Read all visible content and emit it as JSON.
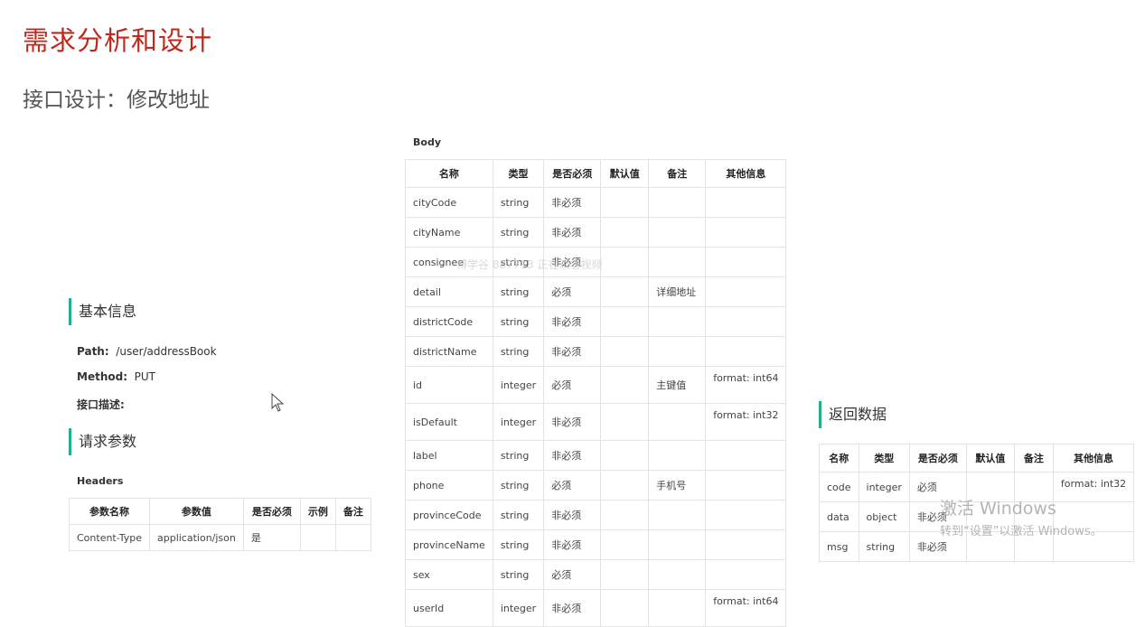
{
  "page": {
    "title": "需求分析和设计",
    "subtitle": "接口设计：修改地址",
    "watermark": "博学谷 887713 正在观看视频"
  },
  "basic": {
    "heading": "基本信息",
    "path_label": "Path:",
    "path_value": "/user/addressBook",
    "method_label": "Method:",
    "method_value": "PUT",
    "desc_label": "接口描述:"
  },
  "request": {
    "heading": "请求参数",
    "headers_label": "Headers",
    "headers_columns": [
      "参数名称",
      "参数值",
      "是否必须",
      "示例",
      "备注"
    ],
    "headers_rows": [
      [
        "Content-Type",
        "application/json",
        "是",
        "",
        ""
      ]
    ]
  },
  "body": {
    "label": "Body",
    "columns": [
      "名称",
      "类型",
      "是否必须",
      "默认值",
      "备注",
      "其他信息"
    ],
    "rows": [
      [
        "cityCode",
        "string",
        "非必须",
        "",
        "",
        ""
      ],
      [
        "cityName",
        "string",
        "非必须",
        "",
        "",
        ""
      ],
      [
        "consignee",
        "string",
        "非必须",
        "",
        "",
        ""
      ],
      [
        "detail",
        "string",
        "必须",
        "",
        "详细地址",
        ""
      ],
      [
        "districtCode",
        "string",
        "非必须",
        "",
        "",
        ""
      ],
      [
        "districtName",
        "string",
        "非必须",
        "",
        "",
        ""
      ],
      [
        "id",
        "integer",
        "必须",
        "",
        "主键值",
        "format: int64"
      ],
      [
        "isDefault",
        "integer",
        "非必须",
        "",
        "",
        "format: int32"
      ],
      [
        "label",
        "string",
        "非必须",
        "",
        "",
        ""
      ],
      [
        "phone",
        "string",
        "必须",
        "",
        "手机号",
        ""
      ],
      [
        "provinceCode",
        "string",
        "非必须",
        "",
        "",
        ""
      ],
      [
        "provinceName",
        "string",
        "非必须",
        "",
        "",
        ""
      ],
      [
        "sex",
        "string",
        "必须",
        "",
        "",
        ""
      ],
      [
        "userId",
        "integer",
        "非必须",
        "",
        "",
        "format: int64"
      ]
    ]
  },
  "response": {
    "heading": "返回数据",
    "columns": [
      "名称",
      "类型",
      "是否必须",
      "默认值",
      "备注",
      "其他信息"
    ],
    "rows": [
      [
        "code",
        "integer",
        "必须",
        "",
        "",
        "format: int32"
      ],
      [
        "data",
        "object",
        "非必须",
        "",
        "",
        ""
      ],
      [
        "msg",
        "string",
        "非必须",
        "",
        "",
        ""
      ]
    ]
  },
  "windows": {
    "activate_title": "激活 Windows",
    "activate_hint": "转到“设置”以激活 Windows。"
  },
  "icons": {
    "cursor": "mouse-pointer-icon"
  }
}
